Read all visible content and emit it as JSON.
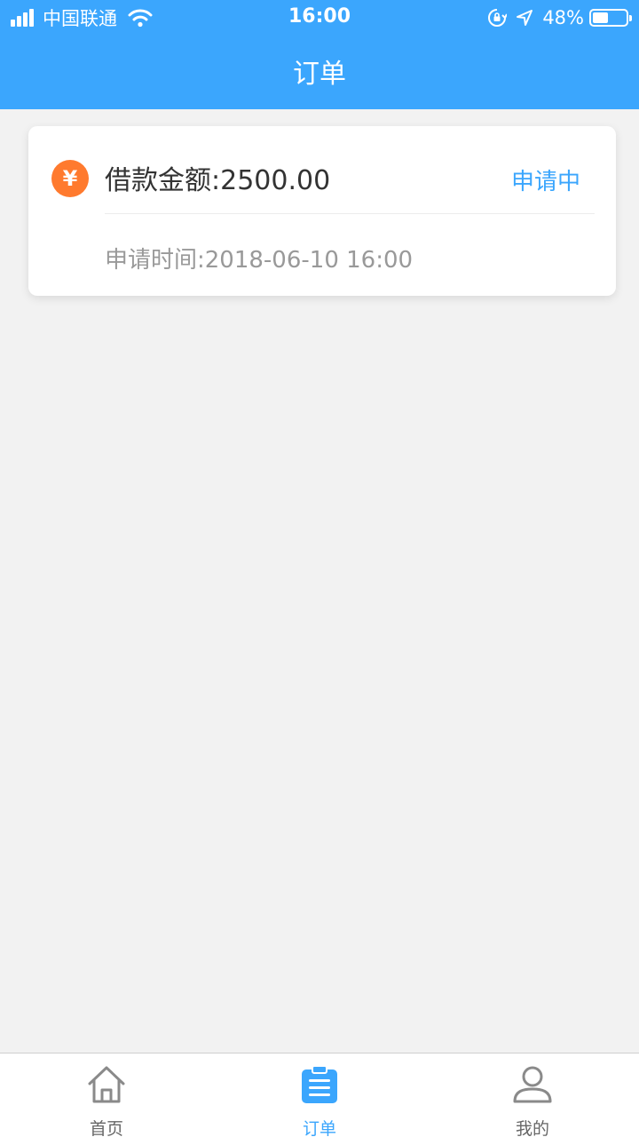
{
  "status_bar": {
    "carrier": "中国联通",
    "time": "16:00",
    "battery": "48%",
    "battery_level": 0.48
  },
  "header": {
    "title": "订单"
  },
  "order": {
    "icon": "yen-icon",
    "icon_glyph": "¥",
    "amount": "借款金额:2500.00",
    "status": "申请中",
    "apply_time": "申请时间:2018-06-10 16:00"
  },
  "tabs": [
    {
      "label": "首页",
      "icon": "home-icon",
      "active": false
    },
    {
      "label": "订单",
      "icon": "clipboard-icon",
      "active": true
    },
    {
      "label": "我的",
      "icon": "user-icon",
      "active": false
    }
  ],
  "colors": {
    "primary": "#3ba6fd",
    "icon_orange": "#ff7a2e",
    "background": "#f2f2f2"
  }
}
